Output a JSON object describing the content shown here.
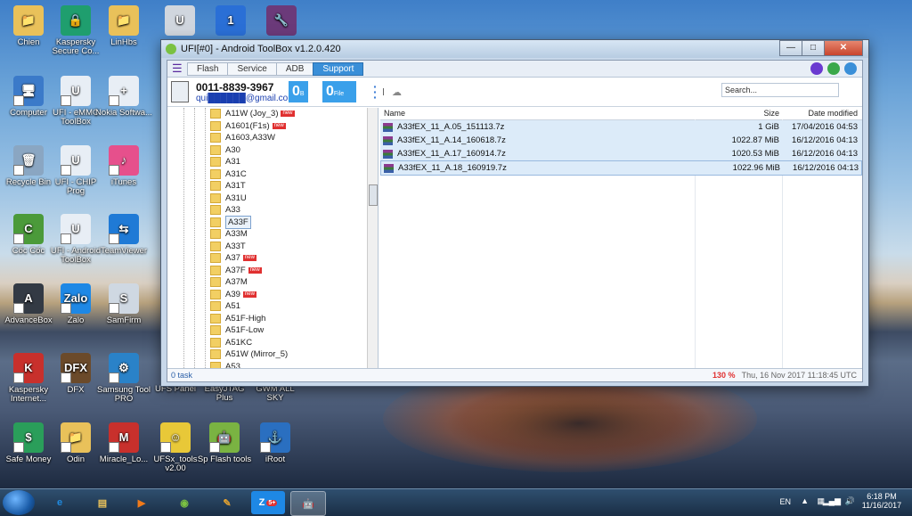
{
  "desktop": {
    "icons": [
      {
        "label": "Chien",
        "color": "#e9c15a",
        "glyph": "📁"
      },
      {
        "label": "Kaspersky Secure Co...",
        "color": "#1f9e6e",
        "glyph": "🔒"
      },
      {
        "label": "LinHbs",
        "color": "#e9c15a",
        "glyph": "📁"
      },
      {
        "label": "",
        "color": "#d0d6de",
        "glyph": "U"
      },
      {
        "label": "",
        "color": "#2a6fd6",
        "glyph": "1"
      },
      {
        "label": "",
        "color": "#6b3a7a",
        "glyph": "🔧"
      },
      {
        "label": "Computer",
        "color": "#3b7ac9",
        "glyph": "🖥"
      },
      {
        "label": "UFI - eMMC ToolBox",
        "color": "#e8eef5",
        "glyph": "U"
      },
      {
        "label": "Nokia Softwa...",
        "color": "#e8eef5",
        "glyph": "+"
      },
      {
        "label": "Recycle Bin",
        "color": "#8aa6c2",
        "glyph": "🗑"
      },
      {
        "label": "UFI - CHIP Prog",
        "color": "#e8eef5",
        "glyph": "U"
      },
      {
        "label": "iTunes",
        "color": "#e6508c",
        "glyph": "♪"
      },
      {
        "label": "Cốc Cốc",
        "color": "#4b9a3a",
        "glyph": "C"
      },
      {
        "label": "UFI - Android ToolBox",
        "color": "#e8eef5",
        "glyph": "U"
      },
      {
        "label": "TeamViewer",
        "color": "#1f7ad6",
        "glyph": "⇆"
      },
      {
        "label": "AdvanceBox",
        "color": "#333a44",
        "glyph": "A"
      },
      {
        "label": "Zalo",
        "color": "#1e88e5",
        "glyph": "Zalo"
      },
      {
        "label": "SamFirm",
        "color": "#cfd8e2",
        "glyph": "S"
      },
      {
        "label": "Kaspersky Internet...",
        "color": "#c8302c",
        "glyph": "K"
      },
      {
        "label": "DFX",
        "color": "#6b4a2a",
        "glyph": "DFX"
      },
      {
        "label": "Samsung Tool PRO",
        "color": "#2a82c8",
        "glyph": "⚙"
      },
      {
        "label": "UFS Panel",
        "color": "",
        "glyph": ""
      },
      {
        "label": "EasyJTAG Plus",
        "color": "",
        "glyph": ""
      },
      {
        "label": "GWM ALL SKY",
        "color": "",
        "glyph": ""
      },
      {
        "label": "Safe Money",
        "color": "#2a9e5a",
        "glyph": "$"
      },
      {
        "label": "Odin",
        "color": "#e9c15a",
        "glyph": "📁"
      },
      {
        "label": "Miracle_Lo...",
        "color": "#c8302c",
        "glyph": "M"
      },
      {
        "label": "UFSx_tools v2.00",
        "color": "#e8c838",
        "glyph": "☺"
      },
      {
        "label": "Sp Flash tools",
        "color": "#7ab342",
        "glyph": "🤖"
      },
      {
        "label": "iRoot",
        "color": "#2a6fc0",
        "glyph": "⚓"
      }
    ]
  },
  "window": {
    "title": "UFI[#0] - Android ToolBox v1.2.0.420",
    "controls": {
      "minimize": "—",
      "maximize": "□",
      "close": "✕"
    },
    "tabs": [
      {
        "label": "Flash",
        "active": false
      },
      {
        "label": "Service",
        "active": false
      },
      {
        "label": "ADB",
        "active": false
      },
      {
        "label": "Support",
        "active": true
      }
    ],
    "device": {
      "phone": "0011-8839-3967",
      "email": "qui██████@gmail.com",
      "counter1": {
        "value": "0",
        "unit": "B"
      },
      "counter2": {
        "value": "0",
        "unit": "File"
      }
    },
    "search_placeholder": "Search...",
    "tree_items": [
      {
        "label": "A11W (Joy_3)",
        "new": true
      },
      {
        "label": "A1601(F1s)",
        "new": true
      },
      {
        "label": "A1603,A33W",
        "new": false
      },
      {
        "label": "A30",
        "new": false
      },
      {
        "label": "A31",
        "new": false
      },
      {
        "label": "A31C",
        "new": false
      },
      {
        "label": "A31T",
        "new": false
      },
      {
        "label": "A31U",
        "new": false
      },
      {
        "label": "A33",
        "new": false
      },
      {
        "label": "A33F",
        "new": false,
        "selected": true
      },
      {
        "label": "A33M",
        "new": false
      },
      {
        "label": "A33T",
        "new": false
      },
      {
        "label": "A37",
        "new": true
      },
      {
        "label": "A37F",
        "new": true
      },
      {
        "label": "A37M",
        "new": false
      },
      {
        "label": "A39",
        "new": true
      },
      {
        "label": "A51",
        "new": false
      },
      {
        "label": "A51F-High",
        "new": false
      },
      {
        "label": "A51F-Low",
        "new": false
      },
      {
        "label": "A51KC",
        "new": false
      },
      {
        "label": "A51W (Mirror_5)",
        "new": false
      },
      {
        "label": "A53",
        "new": false
      }
    ],
    "new_badge": "new",
    "files": {
      "headers": {
        "name": "Name",
        "size": "Size",
        "date": "Date modified"
      },
      "rows": [
        {
          "name": "A33fEX_11_A.05_151113.7z",
          "size": "1 GiB",
          "date": "17/04/2016 04:53"
        },
        {
          "name": "A33fEX_11_A.14_160618.7z",
          "size": "1022.87 MiB",
          "date": "16/12/2016 04:13"
        },
        {
          "name": "A33fEX_11_A.17_160914.7z",
          "size": "1020.53 MiB",
          "date": "16/12/2016 04:13"
        },
        {
          "name": "A33fEX_11_A.18_160919.7z",
          "size": "1022.96 MiB",
          "date": "16/12/2016 04:13"
        }
      ]
    },
    "status": {
      "tasks": "0 task",
      "zoom": "130 %",
      "datetime": "Thu, 16 Nov 2017 11:18:45 UTC"
    }
  },
  "taskbar": {
    "language": "EN",
    "time": "6:18 PM",
    "date": "11/16/2017",
    "zalo_badge": "5+"
  },
  "colors": {
    "accent": "#3a8fd8",
    "new_badge": "#e03030",
    "zoom_text": "#e03030"
  }
}
